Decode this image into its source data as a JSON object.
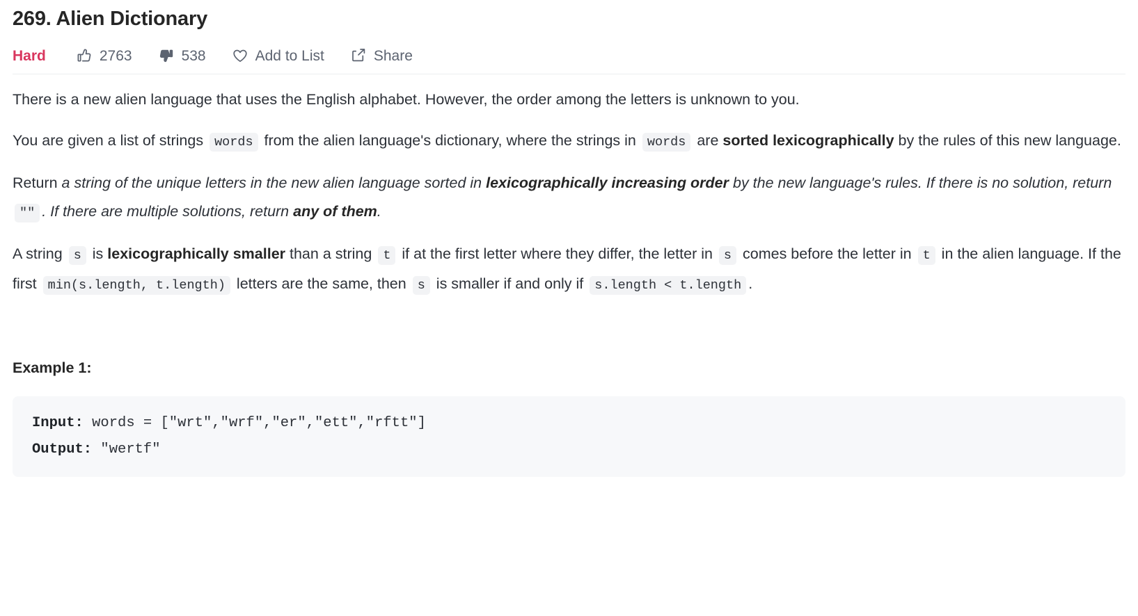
{
  "problem": {
    "title": "269. Alien Dictionary",
    "difficulty": "Hard"
  },
  "actions": {
    "likes": "2763",
    "dislikes": "538",
    "add_to_list": "Add to List",
    "share": "Share"
  },
  "description": {
    "p1": "There is a new alien language that uses the English alphabet. However, the order among the letters is unknown to you.",
    "p2": {
      "t1": "You are given a list of strings ",
      "code1": "words",
      "t2": " from the alien language's dictionary, where the strings in ",
      "code2": "words",
      "t3": " are ",
      "bold1": "sorted lexicographically",
      "t4": " by the rules of this new language."
    },
    "p3": {
      "t1": "Return ",
      "i1": "a string of the unique letters in the new alien language sorted in ",
      "bi1": "lexicographically increasing order",
      "i2": " by the new language's rules. If there is no solution, return ",
      "code1": "\"\"",
      "i3": ". If there are multiple solutions, return ",
      "bi2": "any of them",
      "i4": "."
    },
    "p4": {
      "t1": "A string ",
      "code1": "s",
      "t2": " is ",
      "bold1": "lexicographically smaller",
      "t3": " than a string ",
      "code2": "t",
      "t4": " if at the first letter where they differ, the letter in ",
      "code3": "s",
      "t5": " comes before the letter in ",
      "code4": "t",
      "t6": " in the alien language. If the first ",
      "code5": "min(s.length, t.length)",
      "t7": " letters are the same, then ",
      "code6": "s",
      "t8": " is smaller if and only if ",
      "code7": "s.length < t.length",
      "t9": "."
    }
  },
  "example": {
    "heading": "Example 1:",
    "input_label": "Input:",
    "input_value": " words = [\"wrt\",\"wrf\",\"er\",\"ett\",\"rftt\"]",
    "output_label": "Output:",
    "output_value": " \"wertf\""
  },
  "colors": {
    "hard": "#d9365e",
    "meta_text": "#5c6370",
    "body_text": "#2d3138",
    "code_bg": "#f2f3f5",
    "block_bg": "#f7f8fa",
    "divider": "#eceef0"
  }
}
